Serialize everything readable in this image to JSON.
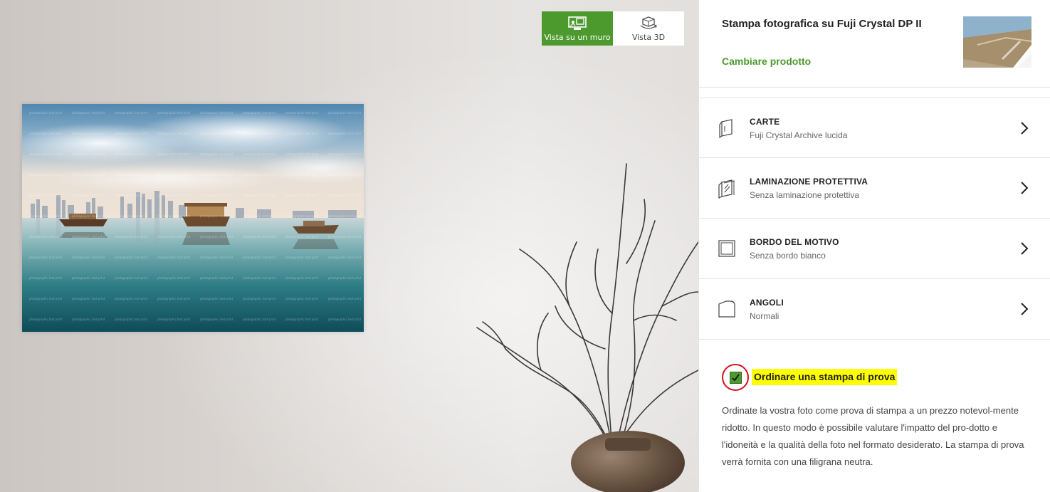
{
  "view_toggle": {
    "wall_label": "Vista su un muro",
    "view3d_label": "Vista 3D"
  },
  "preview": {
    "watermark_text": "photographic test print"
  },
  "product": {
    "title": "Stampa fotografica su Fuji Crystal DP II",
    "change_label": "Cambiare prodotto"
  },
  "options": [
    {
      "title": "CARTE",
      "value": "Fuji Crystal Archive lucida",
      "icon": "paper-icon"
    },
    {
      "title": "LAMINAZIONE PROTETTIVA",
      "value": "Senza laminazione protettiva",
      "icon": "laminate-icon"
    },
    {
      "title": "BORDO DEL MOTIVO",
      "value": "Senza bordo bianco",
      "icon": "border-icon"
    },
    {
      "title": "ANGOLI",
      "value": "Normali",
      "icon": "corners-icon"
    }
  ],
  "proof": {
    "checked": true,
    "label": "Ordinare una stampa di prova",
    "description": "Ordinate la vostra foto come prova di stampa a un prezzo notevol-mente ridotto. In questo modo è possibile valutare l'impatto del pro-dotto e l'idoneità e la qualità della foto nel formato desiderato. La stampa di prova verrà fornita con una filigrana neutra."
  },
  "colors": {
    "accent_green": "#4c9a2e",
    "highlight": "#ffff00",
    "circle_red": "#d6101d"
  }
}
